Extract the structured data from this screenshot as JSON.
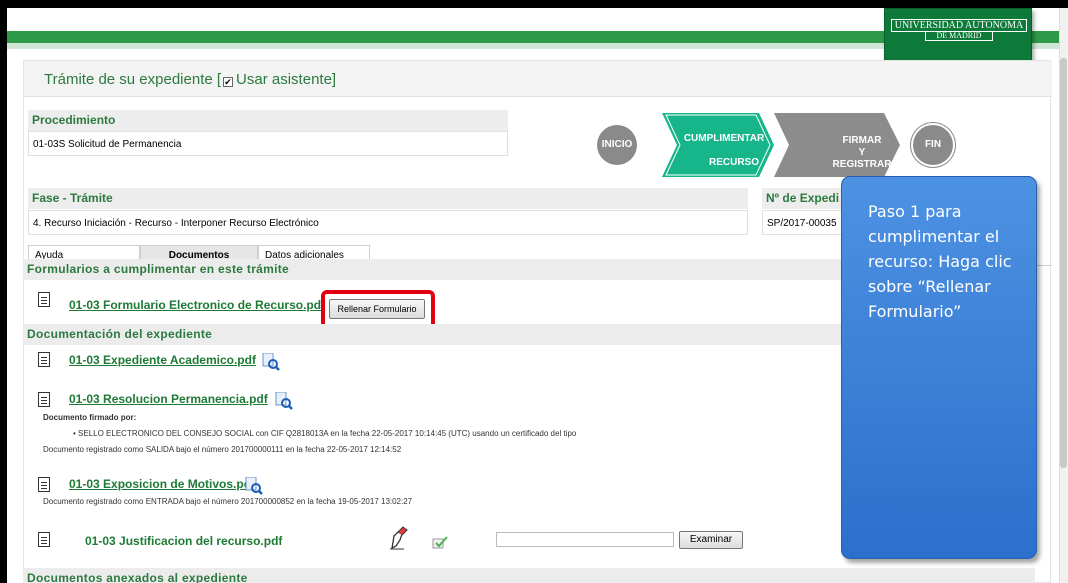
{
  "header": {
    "logo_line1": "UNIVERSIDAD AUTONOMA",
    "logo_line2": "DE MADRID",
    "title_prefix": "Trámite de su expediente  [",
    "title_check": "✔",
    "title_suffix": "Usar asistente]"
  },
  "procedimiento": {
    "label": "Procedimiento",
    "value": "01-03S Solicitud de Permanencia"
  },
  "steps": {
    "inicio": "INICIO",
    "cumplimentar_1": "CUMPLIMENTAR",
    "cumplimentar_2": "RECURSO",
    "firmar_1": "FIRMAR",
    "firmar_2": "Y",
    "firmar_3": "REGISTRAR",
    "fin": "FIN"
  },
  "fase": {
    "label": "Fase - Trámite",
    "value": "4. Recurso Iniciación - Recurso - Interponer Recurso Electrónico"
  },
  "expediente": {
    "label": "Nº de Expedi",
    "value": "SP/2017-00035"
  },
  "tabs": [
    {
      "label": "Ayuda"
    },
    {
      "label": "Documentos"
    },
    {
      "label": "Datos adicionales"
    }
  ],
  "section_forms": "Formularios a cumplimentar en este trámite",
  "form_doc": {
    "name": "01-03 Formulario Electronico de Recurso.pdf",
    "button": "Rellenar Formulario"
  },
  "section_docs": "Documentación del expediente",
  "docs": [
    {
      "name": "01-03 Expediente Academico.pdf"
    },
    {
      "name": "01-03 Resolucion Permanencia.pdf",
      "signed_by": "Documento firmado por:",
      "signer": "•   SELLO ELECTRONICO DEL CONSEJO SOCIAL  con CIF Q2818013A en la fecha 22-05-2017 10:14:45 (UTC) usando un certificado del tipo",
      "registry": "Documento registrado como SALIDA bajo el número 201700000111 en la fecha 22-05-2017 12:14:52"
    },
    {
      "name": "01-03 Exposicion de Motivos.pdf",
      "registry": "Documento registrado como ENTRADA bajo el número 201700000852 en la fecha 19-05-2017 13:02:27"
    },
    {
      "name": "01-03 Justificacion del recurso.pdf",
      "browse": "Examinar"
    }
  ],
  "section_annexed": "Documentos anexados al expediente",
  "callout": {
    "text": "Paso 1 para cumplimentar el recurso: Haga clic sobre “Rellenar Formulario”"
  },
  "colors": {
    "brand_green": "#2e9a47",
    "link_green": "#1e7a34",
    "highlight_red": "#e1000f",
    "callout_blue": "#3d80d8"
  }
}
